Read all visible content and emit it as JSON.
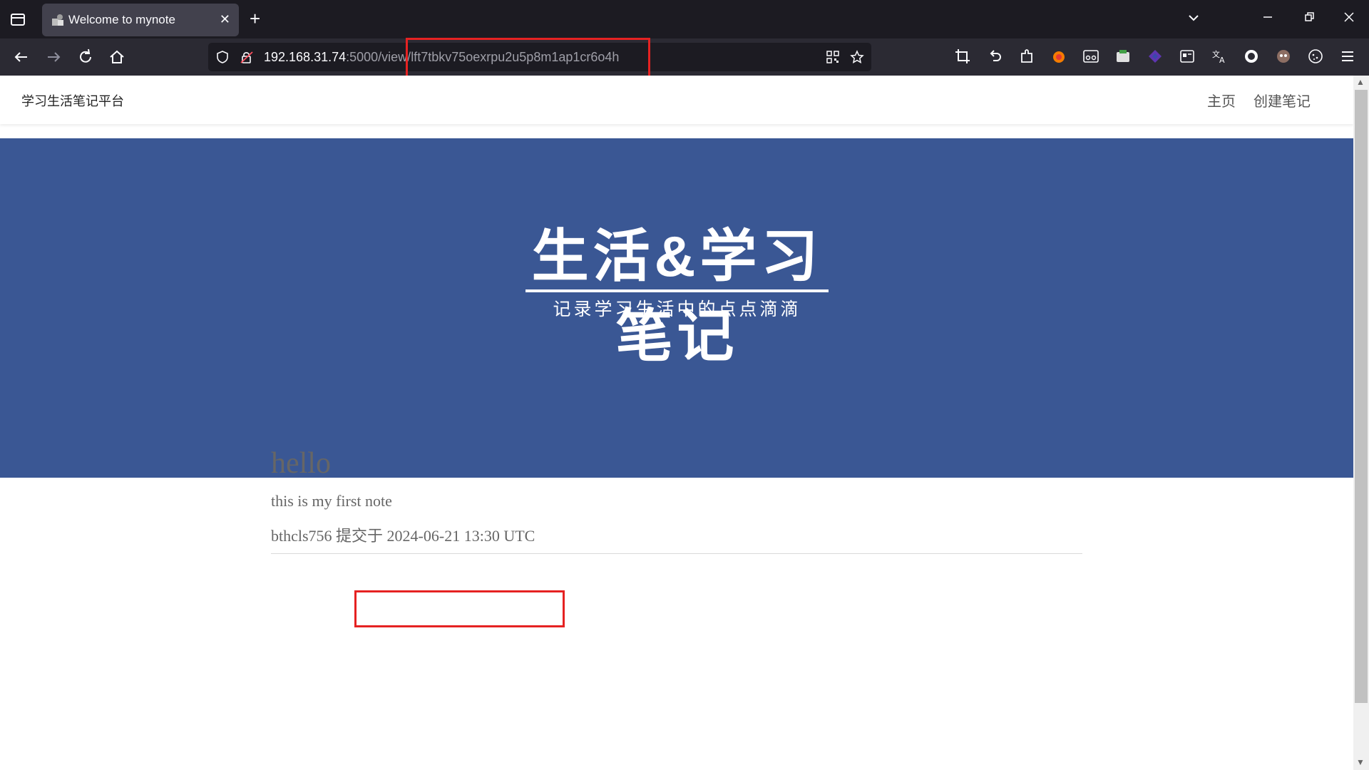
{
  "browser": {
    "tab_title": "Welcome to mynote",
    "tab_close": "✕",
    "new_tab": "+",
    "url_host": "192.168.31.74",
    "url_path_prefix": ":5000/view/",
    "url_id": "lft7tbkv75oexrpu2u5p8m1ap1cr6o4h",
    "icons": {
      "back": "back-icon",
      "forward": "forward-icon",
      "reload": "reload-icon",
      "home": "home-icon",
      "shield": "shield-icon",
      "lock": "lock-icon",
      "qr": "qr-code-icon",
      "star": "bookmark-star-icon",
      "menu": "hamburger-menu-icon"
    }
  },
  "site": {
    "brand": "学习生活笔记平台",
    "nav": {
      "home": "主页",
      "create": "创建笔记"
    }
  },
  "hero": {
    "title": "生活&学习笔记",
    "subtitle": "记录学习生活中的点点滴滴"
  },
  "note": {
    "title": "hello",
    "body": "this is my first note",
    "meta": "bthcls756 提交于 2024-06-21 13:30 UTC"
  },
  "colors": {
    "hero_bg": "#3a5794",
    "highlight": "#e52222",
    "chrome_dark": "#1c1b22",
    "chrome_toolbar": "#2b2a33"
  }
}
